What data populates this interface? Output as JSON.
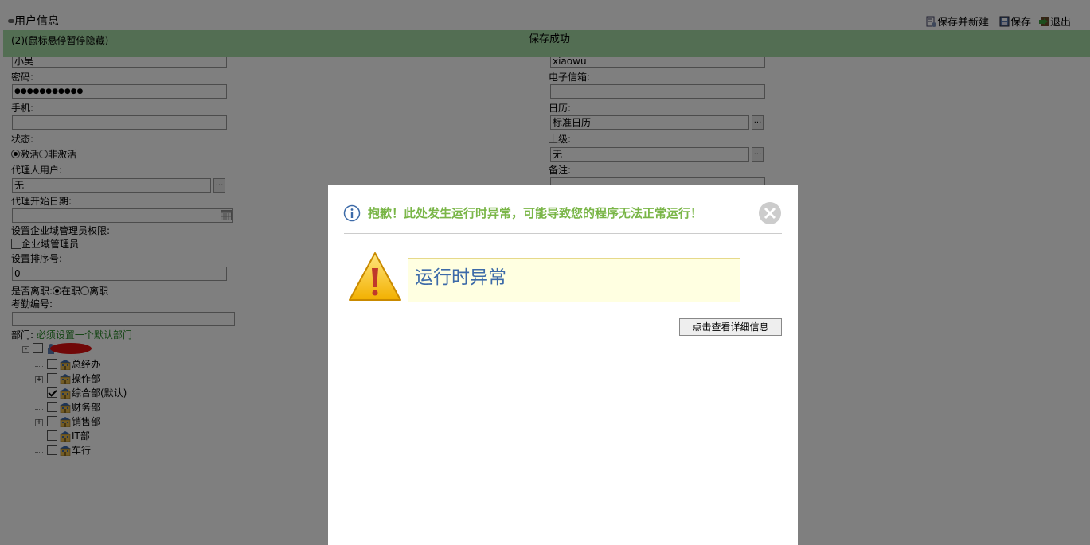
{
  "header": {
    "title": "用户信息"
  },
  "toolbar": {
    "save_new": "保存并新建",
    "save": "保存",
    "exit": "退出"
  },
  "notify": {
    "hint": "(2)(鼠标悬停暂停隐藏)",
    "message": "保存成功"
  },
  "form": {
    "name_value": "小吴",
    "password_label": "密码:",
    "password_value": "●●●●●●●●●●●",
    "mobile_label": "手机:",
    "mobile_value": "",
    "status_label": "状态:",
    "status_active": "激活",
    "status_inactive": "非激活",
    "proxy_label": "代理人用户:",
    "proxy_value": "无",
    "proxy_start_label": "代理开始日期:",
    "proxy_start_value": "",
    "admin_label": "设置企业域管理员权限:",
    "admin_checkbox": "企业域管理员",
    "sort_label": "设置排序号:",
    "sort_value": "0",
    "leave_label": "是否离职:",
    "leave_on": "在职",
    "leave_off": "离职",
    "attendance_label": "考勤编号:",
    "attendance_value": "",
    "dept_label": "部门:",
    "dept_hint": "必须设置一个默认部门",
    "account_value": "xiaowu",
    "email_label": "电子信箱:",
    "email_value": "",
    "calendar_label": "日历:",
    "calendar_value": "标准日历",
    "superior_label": "上级:",
    "superior_value": "无",
    "remark_label": "备注:",
    "dots": "..."
  },
  "tree": {
    "root_label": "",
    "items": [
      {
        "label": "总经办",
        "expander": false,
        "checked": false
      },
      {
        "label": "操作部",
        "expander": true,
        "checked": false
      },
      {
        "label": "综合部(默认)",
        "expander": false,
        "checked": true
      },
      {
        "label": "财务部",
        "expander": false,
        "checked": false
      },
      {
        "label": "销售部",
        "expander": true,
        "checked": false
      },
      {
        "label": "IT部",
        "expander": false,
        "checked": false
      },
      {
        "label": "车行",
        "expander": false,
        "checked": false
      }
    ]
  },
  "dialog": {
    "title": "抱歉！此处发生运行时异常，可能导致您的程序无法正常运行！",
    "error_text": "运行时异常",
    "detail_button": "点击查看详细信息",
    "title_color": "#7ab648",
    "error_color": "#3c6aa8"
  },
  "colors": {
    "notify_bg": "#a7dca7",
    "overlay": "rgba(0,0,0,0.5)"
  }
}
